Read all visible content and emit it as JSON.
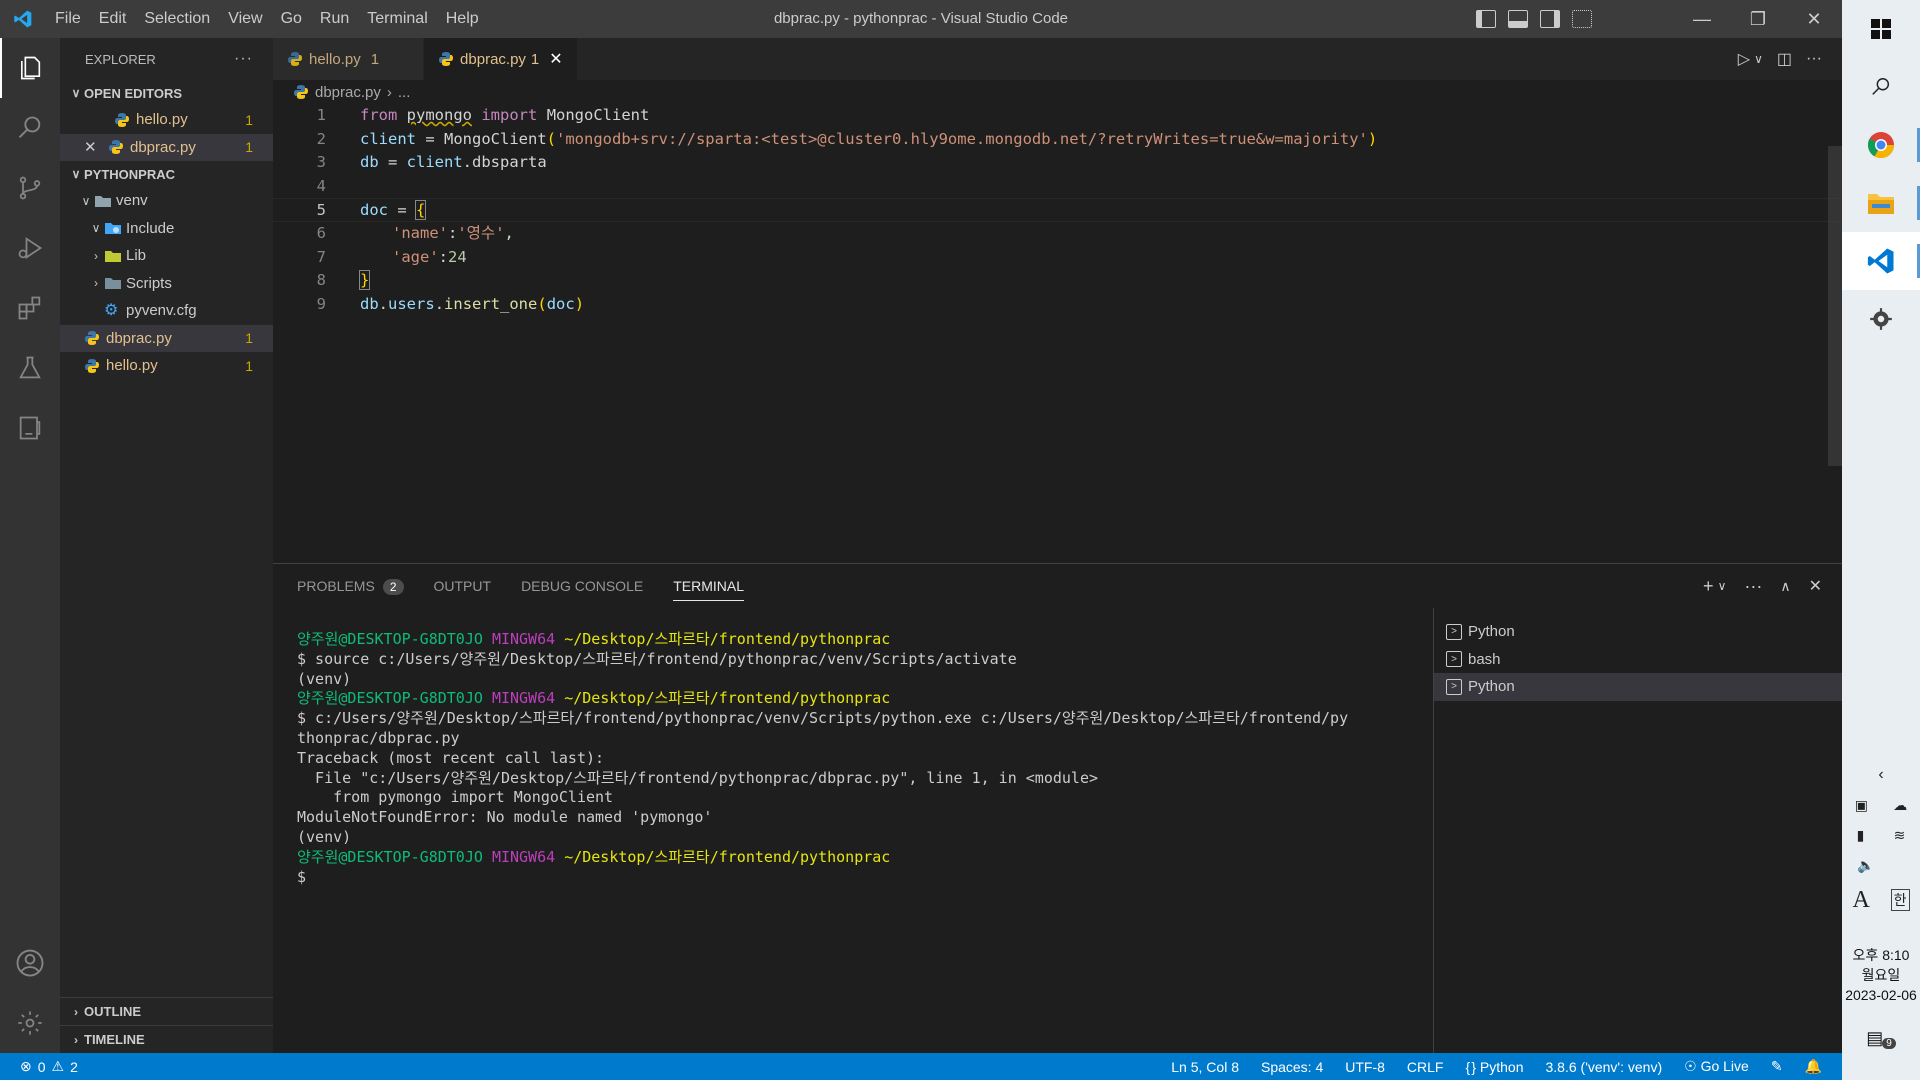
{
  "titlebar": {
    "menus": [
      "File",
      "Edit",
      "Selection",
      "View",
      "Go",
      "Run",
      "Terminal",
      "Help"
    ],
    "title": "dbprac.py - pythonprac - Visual Studio Code"
  },
  "activity": {
    "icons": [
      "files-icon",
      "search-icon",
      "source-control-icon",
      "run-debug-icon",
      "extensions-icon",
      "testing-icon",
      "remote-explorer-icon"
    ],
    "bottom": [
      "accounts-icon",
      "settings-gear-icon"
    ]
  },
  "sidebar": {
    "header": "EXPLORER",
    "open_editors_title": "OPEN EDITORS",
    "open_editors": [
      {
        "name": "hello.py",
        "badge": "1"
      },
      {
        "name": "dbprac.py",
        "badge": "1"
      }
    ],
    "project_title": "PYTHONPRAC",
    "tree": [
      {
        "name": "venv",
        "badge": ""
      },
      {
        "name": "Include",
        "badge": ""
      },
      {
        "name": "Lib",
        "badge": ""
      },
      {
        "name": "Scripts",
        "badge": ""
      },
      {
        "name": "pyvenv.cfg",
        "badge": ""
      },
      {
        "name": "dbprac.py",
        "badge": "1"
      },
      {
        "name": "hello.py",
        "badge": "1"
      }
    ],
    "outline": "OUTLINE",
    "timeline": "TIMELINE"
  },
  "tabs": [
    {
      "label": "hello.py",
      "badge": "1"
    },
    {
      "label": "dbprac.py",
      "badge": "1"
    }
  ],
  "breadcrumb": {
    "file": "dbprac.py",
    "rest": "..."
  },
  "code": {
    "line_numbers": [
      "1",
      "2",
      "3",
      "4",
      "5",
      "6",
      "7",
      "8",
      "9"
    ],
    "l1": {
      "a": "from",
      "b": "pymongo",
      "c": "import",
      "d": "MongoClient"
    },
    "l2": {
      "a": "client",
      "b": " = ",
      "c": "MongoClient",
      "d": "(",
      "e": "'mongodb+srv://sparta:<test>@cluster0.hly9ome.mongodb.net/?retryWrites=true&w=majority'",
      "f": ")"
    },
    "l3": {
      "a": "db",
      "b": " = ",
      "c": "client",
      "d": ".",
      "e": "dbsparta"
    },
    "l5": {
      "a": "doc",
      "b": " = ",
      "c": "{"
    },
    "l6": {
      "a": "'name'",
      "b": ":",
      "c": "'영수'",
      "d": ","
    },
    "l7": {
      "a": "'age'",
      "b": ":",
      "c": "24"
    },
    "l8": {
      "a": "}"
    },
    "l9": {
      "a": "db",
      "b": ".",
      "c": "users",
      "d": ".",
      "e": "insert_one",
      "f": "(",
      "g": "doc",
      "h": ")"
    }
  },
  "panel": {
    "tabs": [
      "PROBLEMS",
      "OUTPUT",
      "DEBUG CONSOLE",
      "TERMINAL"
    ],
    "problems_count": "2",
    "terminal": {
      "prompt_user": "양주원@DESKTOP-G8DT0JO",
      "prompt_env": "MINGW64",
      "prompt_path": "~/Desktop/스파르타/frontend/pythonprac",
      "cmd1": "$ source c:/Users/양주원/Desktop/스파르타/frontend/pythonprac/venv/Scripts/activate",
      "venv": "(venv)",
      "cmd2a": "$ c:/Users/양주원/Desktop/스파르타/frontend/pythonprac/venv/Scripts/python.exe c:/Users/양주원/Desktop/스파르타/frontend/py",
      "cmd2b": "thonprac/dbprac.py",
      "tb1": "Traceback (most recent call last):",
      "tb2": "  File \"c:/Users/양주원/Desktop/스파르타/frontend/pythonprac/dbprac.py\", line 1, in <module>",
      "tb3": "    from pymongo import MongoClient",
      "tb4": "ModuleNotFoundError: No module named 'pymongo'",
      "last": "$"
    },
    "terminals": [
      "Python",
      "bash",
      "Python"
    ]
  },
  "status": {
    "errors": "0",
    "warnings": "2",
    "position": "Ln 5, Col 8",
    "spaces": "Spaces: 4",
    "encoding": "UTF-8",
    "eol": "CRLF",
    "language": "Python",
    "interpreter": "3.8.6 ('venv': venv)",
    "golive": "Go Live"
  },
  "taskbar": {
    "ime_a": "A",
    "ime_han": "한",
    "time": "오후 8:10",
    "day": "월요일",
    "date": "2023-02-06",
    "notif": "9"
  }
}
